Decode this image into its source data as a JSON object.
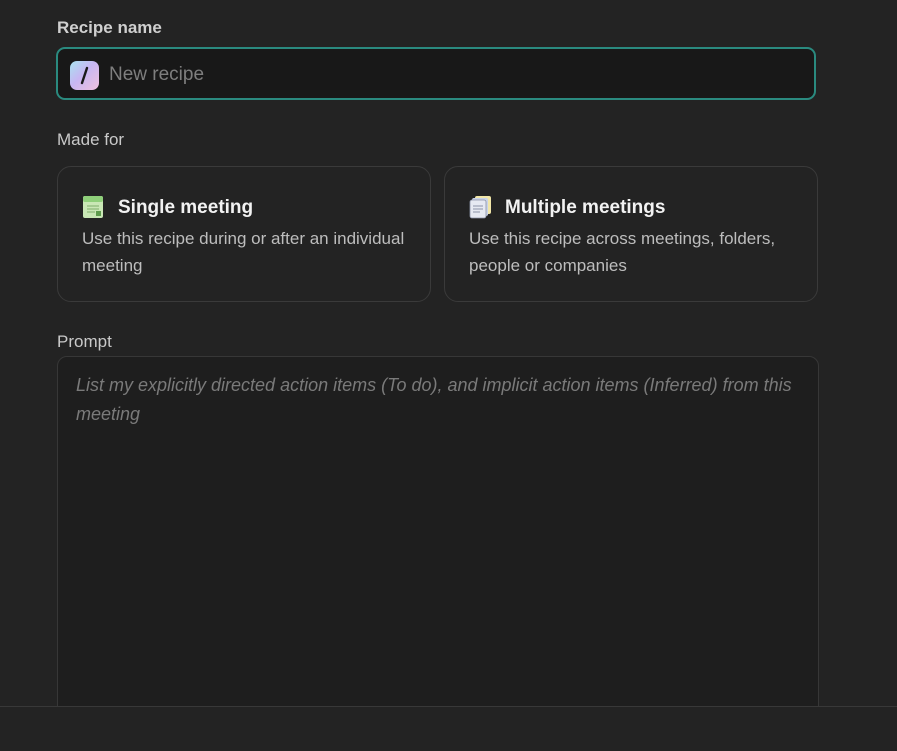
{
  "recipe_name": {
    "label": "Recipe name",
    "placeholder": "New recipe",
    "value": ""
  },
  "made_for": {
    "label": "Made for",
    "options": [
      {
        "title": "Single meeting",
        "description": "Use this recipe during or after an individual meeting",
        "icon": "note-icon"
      },
      {
        "title": "Multiple meetings",
        "description": "Use this recipe across meetings, folders, people or companies",
        "icon": "stacked-notes-icon"
      }
    ]
  },
  "prompt": {
    "label": "Prompt",
    "placeholder": "List my explicitly directed action items (To do), and implicit action items (Inferred) from this meeting",
    "value": ""
  },
  "colors": {
    "background": "#232323",
    "input_focus_border": "#2a8a7f",
    "card_border": "#3a3a3a"
  }
}
